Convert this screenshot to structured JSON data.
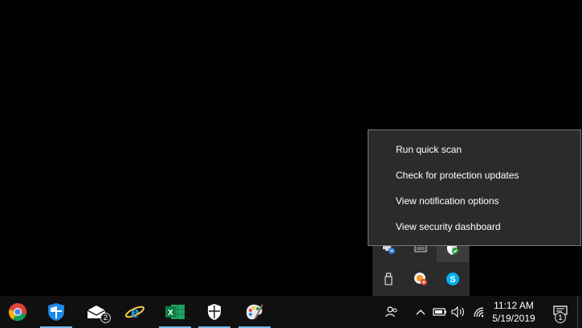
{
  "context_menu": {
    "items": [
      "Run quick scan",
      "Check for protection updates",
      "View notification options",
      "View security dashboard"
    ]
  },
  "taskbar": {
    "apps": [
      {
        "name": "chrome-icon",
        "running": false
      },
      {
        "name": "windows-defender-shield-icon",
        "running": true
      },
      {
        "name": "mail-icon",
        "running": false,
        "badge": "2"
      },
      {
        "name": "internet-explorer-icon",
        "running": false
      },
      {
        "name": "excel-icon",
        "running": true
      },
      {
        "name": "windows-security-icon",
        "running": true
      },
      {
        "name": "paint-icon",
        "running": true
      }
    ],
    "clock": {
      "time": "11:12 AM",
      "date": "5/19/2019"
    },
    "notification_count": "1"
  },
  "colors": {
    "taskbar_bg": "#101010",
    "menu_bg": "#2b2b2b",
    "running_indicator": "#76b9ed",
    "accent_green": "#1e9e3e",
    "skype_blue": "#00aff0"
  }
}
